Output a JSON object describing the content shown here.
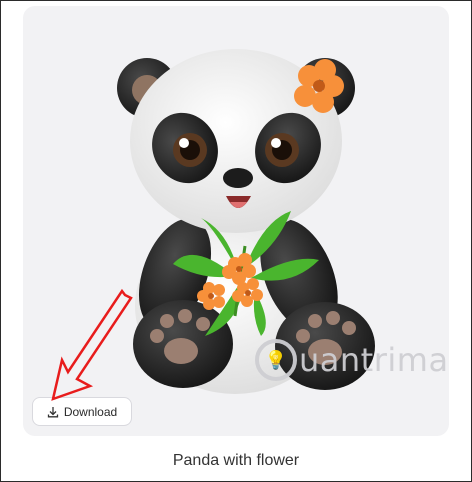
{
  "card": {
    "image_subject": "panda-with-flower-illustration",
    "watermark": {
      "text": "uantrimang",
      "logo_glyph": "💡"
    }
  },
  "download_button": {
    "label": "Download",
    "icon": "download-icon"
  },
  "caption": "Panda with flower",
  "annotation": {
    "arrow_color": "#e81c1c"
  },
  "colors": {
    "card_bg": "#f2f2f4",
    "flower": "#f7903a",
    "leaf": "#4ab52e"
  }
}
